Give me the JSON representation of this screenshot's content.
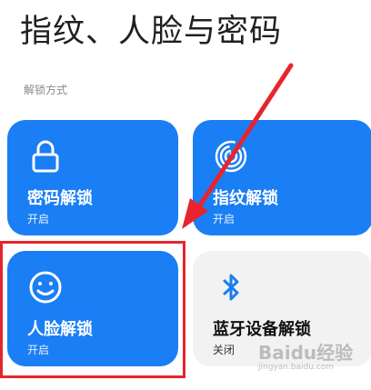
{
  "page": {
    "title": "指纹、人脸与密码",
    "section_label": "解锁方式"
  },
  "cards": {
    "password": {
      "label": "密码解锁",
      "status": "开启",
      "icon": "lock-icon"
    },
    "fingerprint": {
      "label": "指纹解锁",
      "status": "开启",
      "icon": "fingerprint-icon"
    },
    "face": {
      "label": "人脸解锁",
      "status": "开启",
      "icon": "smiley-face-icon"
    },
    "bluetooth": {
      "label": "蓝牙设备解锁",
      "status": "关闭",
      "icon": "bluetooth-icon"
    }
  },
  "colors": {
    "card_active": "#1a7ef5",
    "card_inactive": "#f2f2f2",
    "annotation_red": "#e8242c"
  },
  "watermark": {
    "brand": "Baidu经验",
    "url": "jingyan.baidu.com"
  }
}
